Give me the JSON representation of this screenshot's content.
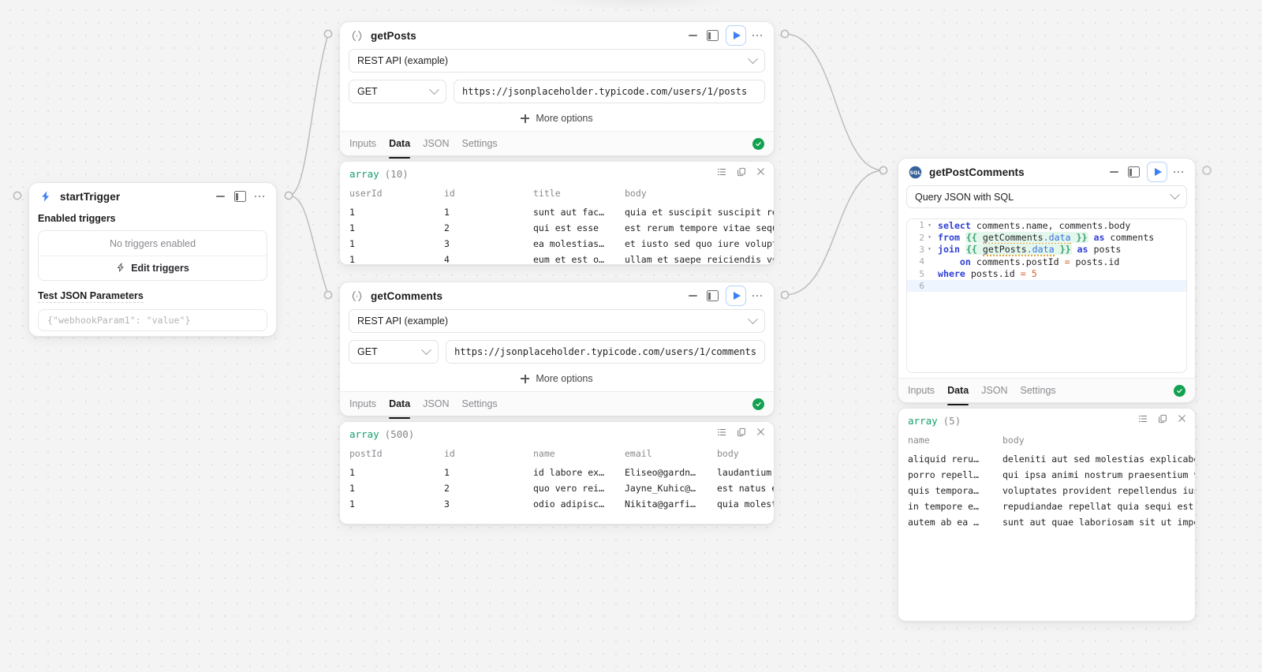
{
  "canvas": {
    "background": "#f4f4f4",
    "dot_color": "#dcdcdc"
  },
  "nodes": {
    "start_trigger": {
      "title": "startTrigger",
      "icon": "lightning-bolt-icon",
      "section_label": "Enabled triggers",
      "empty_text": "No triggers enabled",
      "edit_label": "Edit triggers",
      "params_label": "Test JSON Parameters",
      "params_placeholder": "{\"webhookParam1\": \"value\"}"
    },
    "get_posts": {
      "title": "getPosts",
      "icon": "code-braces-icon",
      "integration": "REST API (example)",
      "method": "GET",
      "url": "https://jsonplaceholder.typicode.com/users/1/posts",
      "more_options": "More options",
      "tabs": [
        "Inputs",
        "Data",
        "JSON",
        "Settings"
      ],
      "active_tab": "Data",
      "status": "success"
    },
    "get_comments": {
      "title": "getComments",
      "icon": "code-braces-icon",
      "integration": "REST API (example)",
      "method": "GET",
      "url": "https://jsonplaceholder.typicode.com/users/1/comments",
      "more_options": "More options",
      "tabs": [
        "Inputs",
        "Data",
        "JSON",
        "Settings"
      ],
      "active_tab": "Data",
      "status": "success"
    },
    "get_post_comments": {
      "title": "getPostComments",
      "icon": "sql-icon",
      "integration": "Query JSON with SQL",
      "tabs": [
        "Inputs",
        "Data",
        "JSON",
        "Settings"
      ],
      "active_tab": "Data",
      "status": "success",
      "sql_lines": [
        {
          "n": "1",
          "fold": true
        },
        {
          "n": "2",
          "fold": true
        },
        {
          "n": "3",
          "fold": true
        },
        {
          "n": "4",
          "fold": false
        },
        {
          "n": "5",
          "fold": false
        },
        {
          "n": "6",
          "fold": false
        }
      ],
      "sql_text": [
        "select comments.name, comments.body",
        "from {{ getComments.data }} as comments",
        "join {{ getPosts.data }} as posts",
        "    on comments.postId = posts.id",
        "where posts.id = 5",
        ""
      ]
    }
  },
  "results": {
    "posts": {
      "type": "array",
      "count": "(10)",
      "columns": [
        "userId",
        "id",
        "title",
        "body"
      ],
      "rows": [
        [
          "1",
          "1",
          "sunt aut fac…",
          "quia et suscipit suscipit recusand…"
        ],
        [
          "1",
          "2",
          "qui est esse",
          "est rerum tempore vitae sequi sint…"
        ],
        [
          "1",
          "3",
          "ea molestias…",
          "et iusto sed quo iure voluptatem o…"
        ],
        [
          "1",
          "4",
          "eum et est o…",
          "ullam et saepe reiciendis voluptat…"
        ]
      ]
    },
    "comments": {
      "type": "array",
      "count": "(500)",
      "columns": [
        "postId",
        "id",
        "name",
        "email",
        "body"
      ],
      "rows": [
        [
          "1",
          "1",
          "id labore ex…",
          "Eliseo@gardn…",
          "laudantium enim qua…"
        ],
        [
          "1",
          "2",
          "quo vero rei…",
          "Jayne_Kuhic@…",
          "est natus enim nihi…"
        ],
        [
          "1",
          "3",
          "odio adipisc…",
          "Nikita@garfi…",
          "quia molestiae repr…"
        ]
      ]
    },
    "post_comments": {
      "type": "array",
      "count": "(5)",
      "columns": [
        "name",
        "body"
      ],
      "rows": [
        [
          "aliquid reru…",
          "deleniti aut sed molestias explicabo c…"
        ],
        [
          "porro repell…",
          "qui ipsa animi nostrum praesentium vol…"
        ],
        [
          "quis tempora…",
          "voluptates provident repellendus iusto…"
        ],
        [
          "in tempore e…",
          "repudiandae repellat quia sequi est do…"
        ],
        [
          "autem ab ea …",
          "sunt aut quae laboriosam sit ut impedi…"
        ]
      ]
    }
  },
  "colors": {
    "accent": "#3b7ff5",
    "success": "#12a150",
    "type_green": "#14a06a",
    "keyword_blue": "#2f3fd6",
    "template_bg": "#e3f7ec"
  }
}
